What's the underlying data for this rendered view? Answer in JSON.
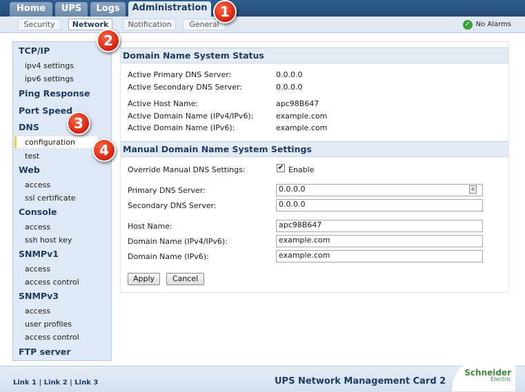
{
  "top_tabs": [
    "Home",
    "UPS",
    "Logs",
    "Administration"
  ],
  "sub_tabs": [
    "Security",
    "Network",
    "Notification",
    "General"
  ],
  "alarm": {
    "icon": "check-icon",
    "text": "No Alarms"
  },
  "sidebar": {
    "tcpip": "TCP/IP",
    "ipv4": "ipv4 settings",
    "ipv6": "ipv6 settings",
    "ping": "Ping Response",
    "port_speed": "Port Speed",
    "dns": "DNS",
    "dns_configuration": "configuration",
    "dns_test": "test",
    "web": "Web",
    "web_access": "access",
    "web_ssl": "ssl certificate",
    "console": "Console",
    "console_access": "access",
    "console_ssh": "ssh host key",
    "snmpv1": "SNMPv1",
    "snmpv1_access": "access",
    "snmpv1_access_control": "access control",
    "snmpv3": "SNMPv3",
    "snmpv3_access": "access",
    "snmpv3_user_profiles": "user profiles",
    "snmpv3_access_control": "access control",
    "ftp": "FTP server"
  },
  "status": {
    "title": "Domain Name System Status",
    "primary_label": "Active Primary DNS Server:",
    "primary_value": "0.0.0.0",
    "secondary_label": "Active Secondary DNS Server:",
    "secondary_value": "0.0.0.0",
    "host_label": "Active Host Name:",
    "host_value": "apc98B647",
    "domain_label": "Active Domain Name (IPv4/IPv6):",
    "domain_value": "example.com",
    "domain6_label": "Active Domain Name (IPv6):",
    "domain6_value": "example.com"
  },
  "manual": {
    "title": "Manual Domain Name System Settings",
    "override_label": "Override Manual DNS Settings:",
    "override_checked": true,
    "enable_label": "Enable",
    "primary_label": "Primary DNS Server:",
    "primary_value": "0.0.0.0",
    "secondary_label": "Secondary DNS Server:",
    "secondary_value": "0.0.0.0",
    "host_label": "Host Name:",
    "host_value": "apc98B647",
    "domain_label": "Domain Name (IPv4/IPv6):",
    "domain_value": "example.com",
    "domain6_label": "Domain Name (IPv6):",
    "domain6_value": "example.com",
    "apply": "Apply",
    "cancel": "Cancel"
  },
  "footer": {
    "link1": "Link 1",
    "link2": "Link 2",
    "link3": "Link 3",
    "separator": "|",
    "title": "UPS Network Management Card 2",
    "logo": "Schneider",
    "logo_sub": "Electric"
  },
  "badges": [
    "1",
    "2",
    "3",
    "4"
  ],
  "colors": {
    "accent": "#2b5482",
    "alarm_ok": "#3aa235",
    "badge": "#d4200e",
    "selected_marker": "#f3d23a"
  }
}
